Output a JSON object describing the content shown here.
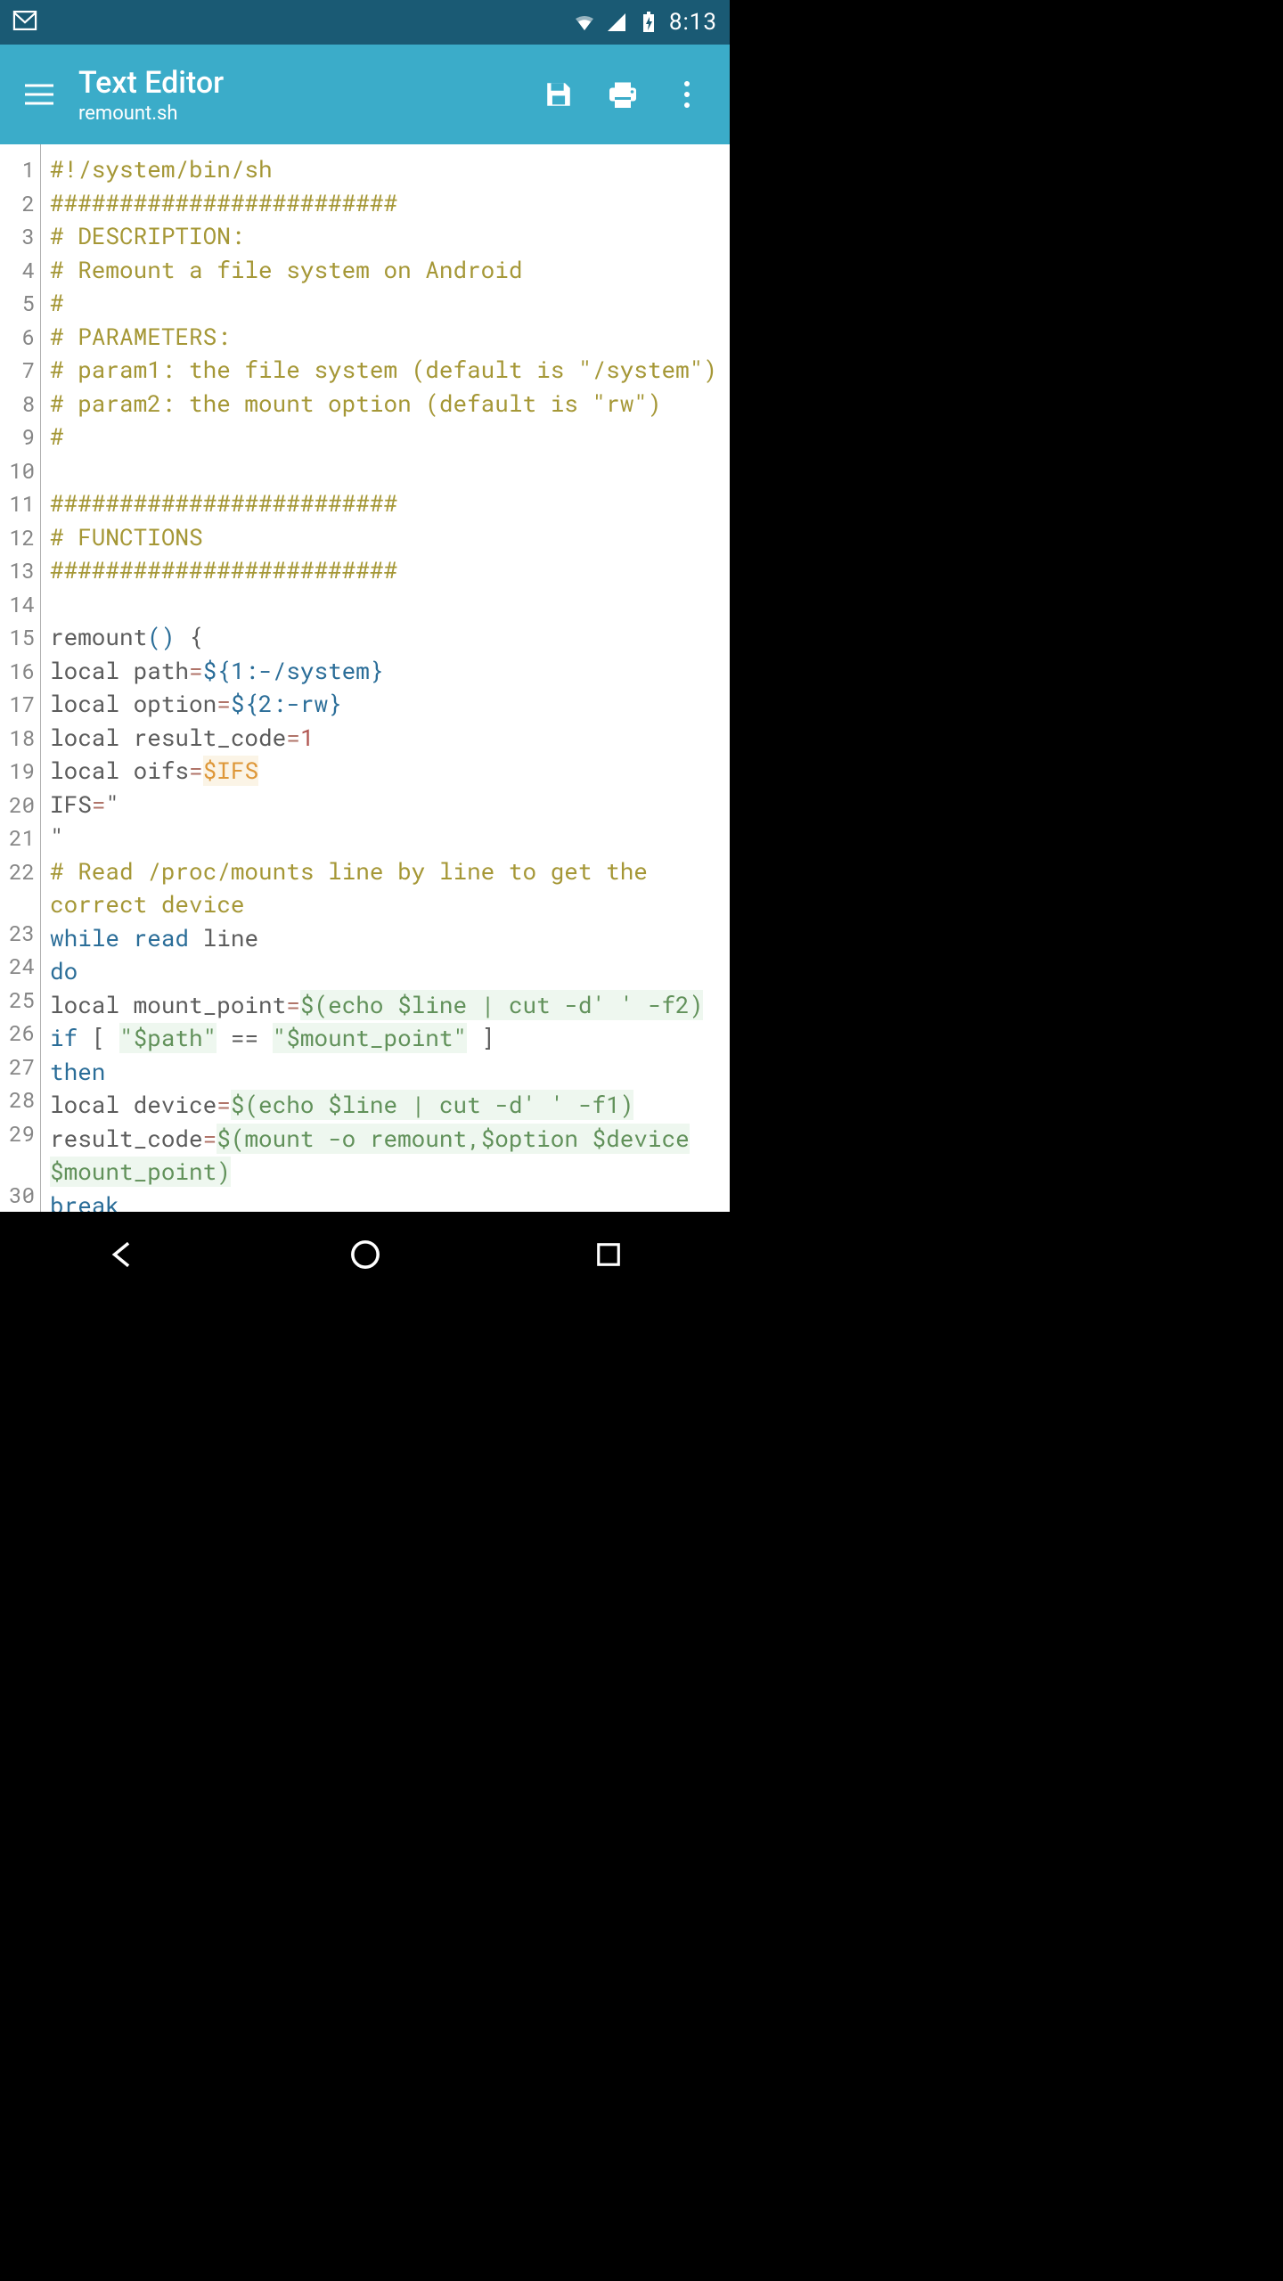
{
  "status": {
    "time": "8:13"
  },
  "app": {
    "title": "Text Editor",
    "subtitle": "remount.sh"
  },
  "code": {
    "lines": [
      {
        "n": 1,
        "t": [
          [
            "comment",
            "#!/system/bin/sh"
          ]
        ]
      },
      {
        "n": 2,
        "t": [
          [
            "comment",
            "#########################"
          ]
        ]
      },
      {
        "n": 3,
        "t": [
          [
            "comment",
            "# DESCRIPTION:"
          ]
        ]
      },
      {
        "n": 4,
        "t": [
          [
            "comment",
            "#   Remount a file system on Android"
          ]
        ]
      },
      {
        "n": 5,
        "t": [
          [
            "comment",
            "#"
          ]
        ]
      },
      {
        "n": 6,
        "t": [
          [
            "comment",
            "# PARAMETERS:"
          ]
        ]
      },
      {
        "n": 7,
        "t": [
          [
            "comment",
            "#   param1: the file system (default is \"/system\")"
          ]
        ]
      },
      {
        "n": 8,
        "t": [
          [
            "comment",
            "#   param2: the mount option (default is \"rw\")"
          ]
        ]
      },
      {
        "n": 9,
        "t": [
          [
            "comment",
            "#"
          ]
        ]
      },
      {
        "n": 10,
        "t": [
          [
            "",
            " "
          ]
        ]
      },
      {
        "n": 11,
        "t": [
          [
            "comment",
            "#########################"
          ]
        ]
      },
      {
        "n": 12,
        "t": [
          [
            "comment",
            "# FUNCTIONS"
          ]
        ]
      },
      {
        "n": 13,
        "t": [
          [
            "comment",
            "#########################"
          ]
        ]
      },
      {
        "n": 14,
        "t": [
          [
            "",
            " "
          ]
        ]
      },
      {
        "n": 15,
        "t": [
          [
            "",
            "remount"
          ],
          [
            "key",
            "()"
          ],
          [
            "",
            " {"
          ]
        ]
      },
      {
        "n": 16,
        "t": [
          [
            "",
            "  local path"
          ],
          [
            "op",
            "="
          ],
          [
            "key",
            "${1:-/system}"
          ]
        ]
      },
      {
        "n": 17,
        "t": [
          [
            "",
            "  local option"
          ],
          [
            "op",
            "="
          ],
          [
            "key",
            "${2:-rw}"
          ]
        ]
      },
      {
        "n": 18,
        "t": [
          [
            "",
            "  local result_code"
          ],
          [
            "op",
            "="
          ],
          [
            "num",
            "1"
          ]
        ]
      },
      {
        "n": 19,
        "t": [
          [
            "",
            "  local oifs"
          ],
          [
            "op",
            "="
          ],
          [
            "var",
            "$IFS"
          ]
        ]
      },
      {
        "n": 20,
        "t": [
          [
            "",
            "  IFS"
          ],
          [
            "op",
            "="
          ],
          [
            "",
            "\""
          ]
        ]
      },
      {
        "n": 21,
        "t": [
          [
            "",
            "\""
          ]
        ]
      },
      {
        "n": 22,
        "t": [
          [
            "",
            "  "
          ],
          [
            "comment",
            "# Read /proc/mounts line by line to get the correct device"
          ]
        ]
      },
      {
        "n": 23,
        "t": [
          [
            "",
            "  "
          ],
          [
            "key",
            "while read"
          ],
          [
            "",
            " line"
          ]
        ]
      },
      {
        "n": 24,
        "t": [
          [
            "",
            "  "
          ],
          [
            "key",
            "do"
          ]
        ]
      },
      {
        "n": 25,
        "t": [
          [
            "",
            "    local mount_point"
          ],
          [
            "op",
            "="
          ],
          [
            "str",
            "$(echo $line | cut -d' ' -f2)"
          ]
        ]
      },
      {
        "n": 26,
        "t": [
          [
            "",
            "    "
          ],
          [
            "key",
            "if"
          ],
          [
            "",
            " [ "
          ],
          [
            "str",
            "\"$path\""
          ],
          [
            "",
            " == "
          ],
          [
            "str",
            "\"$mount_point\""
          ],
          [
            "",
            " ]"
          ]
        ]
      },
      {
        "n": 27,
        "t": [
          [
            "",
            "    "
          ],
          [
            "key",
            "then"
          ]
        ]
      },
      {
        "n": 28,
        "t": [
          [
            "",
            "      local device"
          ],
          [
            "op",
            "="
          ],
          [
            "str",
            "$(echo $line | cut -d' ' -f1)"
          ]
        ]
      },
      {
        "n": 29,
        "t": [
          [
            "",
            "      result_code"
          ],
          [
            "op",
            "="
          ],
          [
            "str",
            "$(mount -o remount,$option $device $mount_point)"
          ]
        ]
      },
      {
        "n": 30,
        "t": [
          [
            "",
            "      "
          ],
          [
            "key",
            "break"
          ]
        ]
      }
    ]
  }
}
